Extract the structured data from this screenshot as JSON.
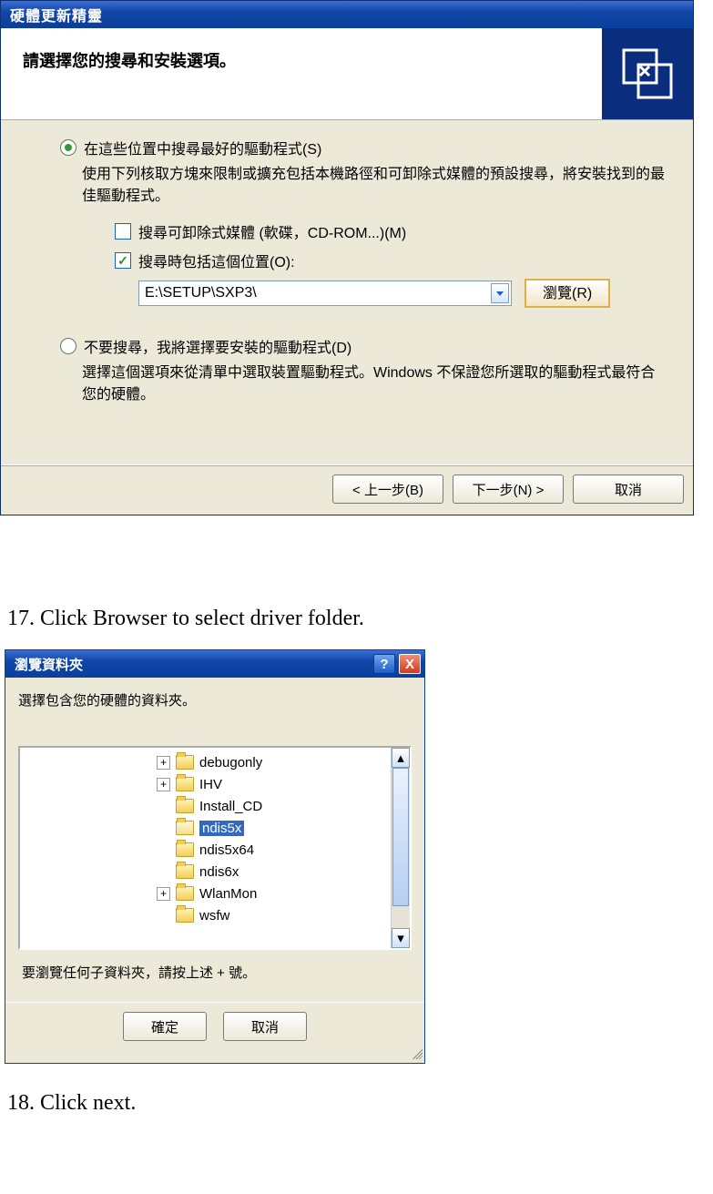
{
  "wizard": {
    "title": "硬體更新精靈",
    "header_text": "請選擇您的搜尋和安裝選項。",
    "opt_search": {
      "label": "在這些位置中搜尋最好的驅動程式(S)",
      "desc": "使用下列核取方塊來限制或擴充包括本機路徑和可卸除式媒體的預設搜尋，將安裝找到的最佳驅動程式。"
    },
    "cb_removable": "搜尋可卸除式媒體 (軟碟，CD-ROM...)(M)",
    "cb_include": "搜尋時包括這個位置(O):",
    "path_value": "E:\\SETUP\\SXP3\\",
    "browse_label": "瀏覽(R)",
    "opt_manual": {
      "label": "不要搜尋，我將選擇要安裝的驅動程式(D)",
      "desc": "選擇這個選項來從清單中選取裝置驅動程式。Windows 不保證您所選取的驅動程式最符合您的硬體。"
    },
    "btn_back": "< 上一步(B)",
    "btn_next": "下一步(N) >",
    "btn_cancel": "取消"
  },
  "doc": {
    "step17": "17. Click Browser to select driver folder.",
    "step18": "18. Click next."
  },
  "browse": {
    "title": "瀏覽資料夾",
    "prompt": "選擇包含您的硬體的資料夾。",
    "items": [
      {
        "label": "debugonly",
        "expander": "+"
      },
      {
        "label": "IHV",
        "expander": "+"
      },
      {
        "label": "Install_CD",
        "expander": ""
      },
      {
        "label": "ndis5x",
        "expander": "",
        "selected": true,
        "open": true
      },
      {
        "label": "ndis5x64",
        "expander": ""
      },
      {
        "label": "ndis6x",
        "expander": ""
      },
      {
        "label": "WlanMon",
        "expander": "+"
      },
      {
        "label": "wsfw",
        "expander": ""
      }
    ],
    "hint": "要瀏覽任何子資料夾，請按上述 + 號。",
    "ok": "確定",
    "cancel": "取消",
    "help": "?",
    "close": "X"
  }
}
